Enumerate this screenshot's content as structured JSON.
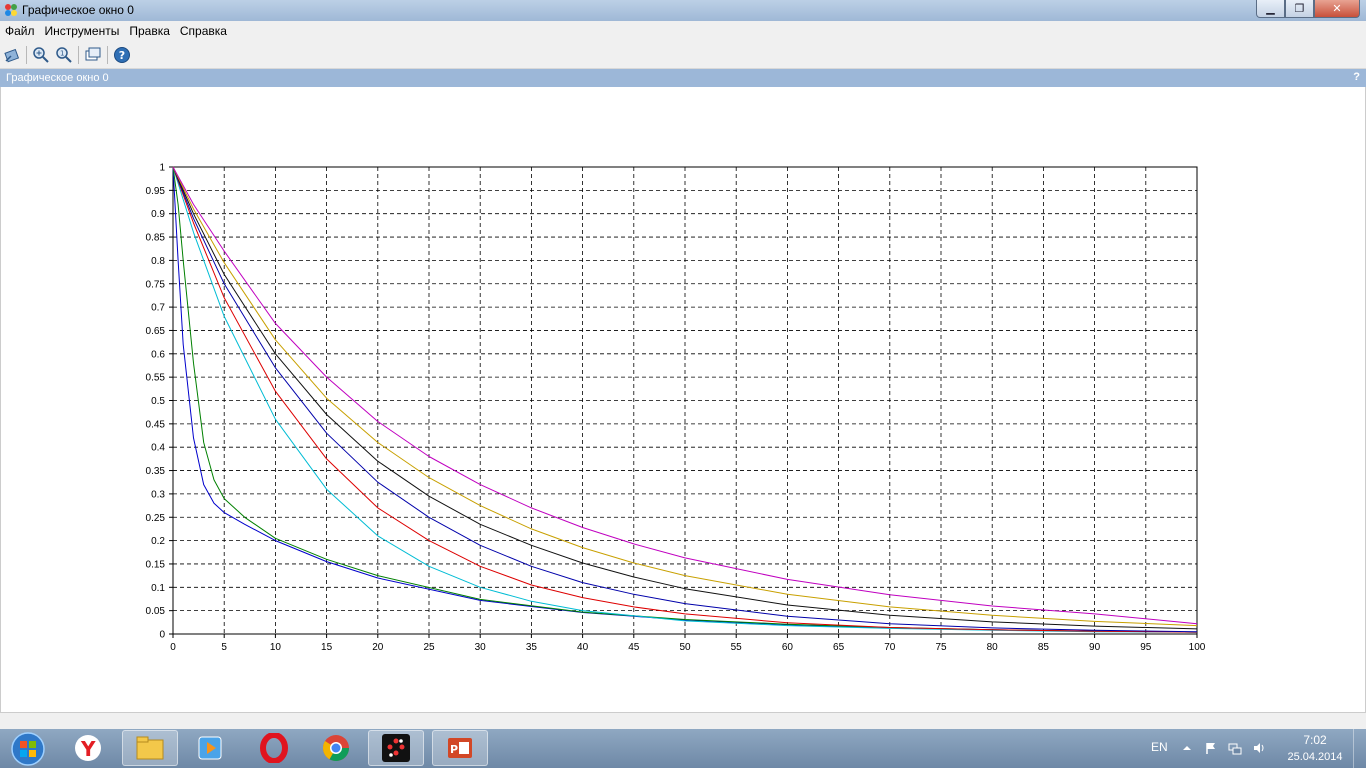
{
  "window": {
    "title": "Графическое окно 0",
    "minimize": "▁",
    "maximize": "❐",
    "close": "✕"
  },
  "menu": [
    {
      "label": "Файл"
    },
    {
      "label": "Инструменты"
    },
    {
      "label": "Правка"
    },
    {
      "label": "Справка"
    }
  ],
  "toolbar": {
    "buttons": [
      {
        "name": "rotate-icon"
      },
      {
        "name": "zoom-in-icon"
      },
      {
        "name": "zoom-reset-icon"
      },
      {
        "name": "select-axes-icon"
      },
      {
        "name": "help-icon"
      }
    ]
  },
  "panel": {
    "title": "Графическое окно 0",
    "help": "?"
  },
  "chart_data": {
    "type": "line",
    "title": "",
    "xlabel": "",
    "ylabel": "",
    "xlim": [
      0,
      100
    ],
    "ylim": [
      0,
      1
    ],
    "grid": true,
    "legend": "none",
    "x_ticks": [
      "0",
      "5",
      "10",
      "15",
      "20",
      "25",
      "30",
      "35",
      "40",
      "45",
      "50",
      "55",
      "60",
      "65",
      "70",
      "75",
      "80",
      "85",
      "90",
      "95",
      "100"
    ],
    "y_ticks": [
      "0",
      "0.05",
      "0.1",
      "0.15",
      "0.2",
      "0.25",
      "0.3",
      "0.35",
      "0.4",
      "0.45",
      "0.5",
      "0.55",
      "0.6",
      "0.65",
      "0.7",
      "0.75",
      "0.8",
      "0.85",
      "0.9",
      "0.95",
      "1"
    ],
    "series": [
      {
        "color": "#0000cc",
        "x": [
          0,
          0.5,
          1,
          2,
          3,
          4,
          5,
          7,
          10,
          15,
          20,
          30,
          40,
          50,
          60,
          70,
          80,
          90,
          100
        ],
        "y": [
          1,
          0.8,
          0.62,
          0.42,
          0.32,
          0.28,
          0.26,
          0.235,
          0.2,
          0.155,
          0.12,
          0.072,
          0.046,
          0.03,
          0.02,
          0.013,
          0.009,
          0.006,
          0.004
        ]
      },
      {
        "color": "#008000",
        "x": [
          0,
          0.5,
          1,
          2,
          3,
          4,
          5,
          7,
          10,
          15,
          20,
          30,
          40,
          50,
          60,
          70,
          80,
          90,
          100
        ],
        "y": [
          1,
          0.92,
          0.8,
          0.58,
          0.41,
          0.33,
          0.29,
          0.25,
          0.205,
          0.16,
          0.125,
          0.074,
          0.047,
          0.031,
          0.021,
          0.014,
          0.009,
          0.006,
          0.004
        ]
      },
      {
        "color": "#00bcd4",
        "x": [
          0,
          2,
          5,
          10,
          15,
          20,
          25,
          30,
          35,
          40,
          50,
          60,
          70,
          80,
          90,
          100
        ],
        "y": [
          1,
          0.86,
          0.68,
          0.46,
          0.31,
          0.21,
          0.145,
          0.1,
          0.07,
          0.05,
          0.028,
          0.018,
          0.012,
          0.008,
          0.005,
          0.004
        ]
      },
      {
        "color": "#dd0000",
        "x": [
          0,
          2,
          5,
          10,
          15,
          20,
          25,
          30,
          35,
          40,
          45,
          50,
          60,
          70,
          80,
          90,
          100
        ],
        "y": [
          1,
          0.88,
          0.72,
          0.52,
          0.375,
          0.27,
          0.2,
          0.145,
          0.105,
          0.078,
          0.058,
          0.043,
          0.024,
          0.014,
          0.009,
          0.006,
          0.004
        ]
      },
      {
        "color": "#0000aa",
        "x": [
          0,
          2,
          5,
          10,
          15,
          20,
          25,
          30,
          35,
          40,
          45,
          50,
          60,
          70,
          80,
          90,
          100
        ],
        "y": [
          1,
          0.89,
          0.75,
          0.57,
          0.43,
          0.325,
          0.25,
          0.19,
          0.145,
          0.11,
          0.085,
          0.065,
          0.038,
          0.022,
          0.013,
          0.008,
          0.005
        ]
      },
      {
        "color": "#111111",
        "x": [
          0,
          2,
          5,
          10,
          15,
          20,
          25,
          30,
          35,
          40,
          45,
          50,
          60,
          70,
          80,
          90,
          100
        ],
        "y": [
          1,
          0.9,
          0.77,
          0.6,
          0.47,
          0.37,
          0.295,
          0.235,
          0.19,
          0.152,
          0.122,
          0.097,
          0.062,
          0.04,
          0.026,
          0.017,
          0.011
        ]
      },
      {
        "color": "#c8a000",
        "x": [
          0,
          2,
          5,
          10,
          15,
          20,
          25,
          30,
          35,
          40,
          45,
          50,
          60,
          70,
          80,
          90,
          100
        ],
        "y": [
          1,
          0.91,
          0.795,
          0.63,
          0.505,
          0.41,
          0.335,
          0.275,
          0.225,
          0.185,
          0.152,
          0.125,
          0.085,
          0.058,
          0.04,
          0.027,
          0.018
        ]
      },
      {
        "color": "#c000c0",
        "x": [
          0,
          2,
          5,
          10,
          15,
          20,
          25,
          30,
          35,
          40,
          45,
          50,
          60,
          70,
          80,
          90,
          100
        ],
        "y": [
          1,
          0.92,
          0.82,
          0.665,
          0.55,
          0.455,
          0.38,
          0.32,
          0.27,
          0.228,
          0.193,
          0.163,
          0.117,
          0.084,
          0.06,
          0.043,
          0.022
        ]
      }
    ]
  },
  "taskbar": {
    "apps": [
      {
        "name": "yandex-browser-icon",
        "active": false
      },
      {
        "name": "file-explorer-icon",
        "active": true
      },
      {
        "name": "media-player-icon",
        "active": false
      },
      {
        "name": "opera-icon",
        "active": false
      },
      {
        "name": "chrome-icon",
        "active": false
      },
      {
        "name": "scilab-icon",
        "active": true
      },
      {
        "name": "powerpoint-icon",
        "active": true
      }
    ],
    "lang": "EN",
    "time": "7:02",
    "date": "25.04.2014"
  }
}
